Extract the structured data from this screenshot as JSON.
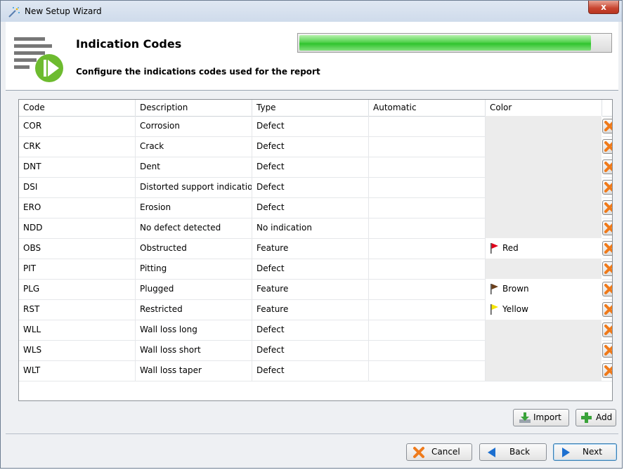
{
  "window": {
    "title": "New Setup Wizard",
    "icon": "wand-icon",
    "close_label": "x"
  },
  "header": {
    "title": "Indication Codes",
    "subtitle": "Configure the indications codes used for the report",
    "progress_fraction": 0.94
  },
  "table": {
    "columns": [
      "Code",
      "Description",
      "Type",
      "Automatic",
      "Color"
    ],
    "rows": [
      {
        "code": "COR",
        "description": "Corrosion",
        "type": "Defect",
        "automatic": "",
        "color": "",
        "flag": ""
      },
      {
        "code": "CRK",
        "description": "Crack",
        "type": "Defect",
        "automatic": "",
        "color": "",
        "flag": ""
      },
      {
        "code": "DNT",
        "description": "Dent",
        "type": "Defect",
        "automatic": "",
        "color": "",
        "flag": ""
      },
      {
        "code": "DSI",
        "description": "Distorted support indicatio",
        "type": "Defect",
        "automatic": "",
        "color": "",
        "flag": ""
      },
      {
        "code": "ERO",
        "description": "Erosion",
        "type": "Defect",
        "automatic": "",
        "color": "",
        "flag": ""
      },
      {
        "code": "NDD",
        "description": "No defect detected",
        "type": "No indication",
        "automatic": "",
        "color": "",
        "flag": ""
      },
      {
        "code": "OBS",
        "description": "Obstructed",
        "type": "Feature",
        "automatic": "",
        "color": "Red",
        "flag": "#e0001a"
      },
      {
        "code": "PIT",
        "description": "Pitting",
        "type": "Defect",
        "automatic": "",
        "color": "",
        "flag": ""
      },
      {
        "code": "PLG",
        "description": "Plugged",
        "type": "Feature",
        "automatic": "",
        "color": "Brown",
        "flag": "#6b3f1a"
      },
      {
        "code": "RST",
        "description": "Restricted",
        "type": "Feature",
        "automatic": "",
        "color": "Yellow",
        "flag": "#f5e400"
      },
      {
        "code": "WLL",
        "description": "Wall loss long",
        "type": "Defect",
        "automatic": "",
        "color": "",
        "flag": ""
      },
      {
        "code": "WLS",
        "description": "Wall loss short",
        "type": "Defect",
        "automatic": "",
        "color": "",
        "flag": ""
      },
      {
        "code": "WLT",
        "description": "Wall loss taper",
        "type": "Defect",
        "automatic": "",
        "color": "",
        "flag": ""
      }
    ],
    "delete_icon": "delete-x-icon"
  },
  "actions": {
    "import_label": "Import",
    "add_label": "Add"
  },
  "footer": {
    "cancel_label": "Cancel",
    "back_label": "Back",
    "next_label": "Next"
  },
  "colors": {
    "delete_orange": "#f07a1a",
    "progress_green": "#3bc93a",
    "nav_blue": "#1c6fd0"
  }
}
